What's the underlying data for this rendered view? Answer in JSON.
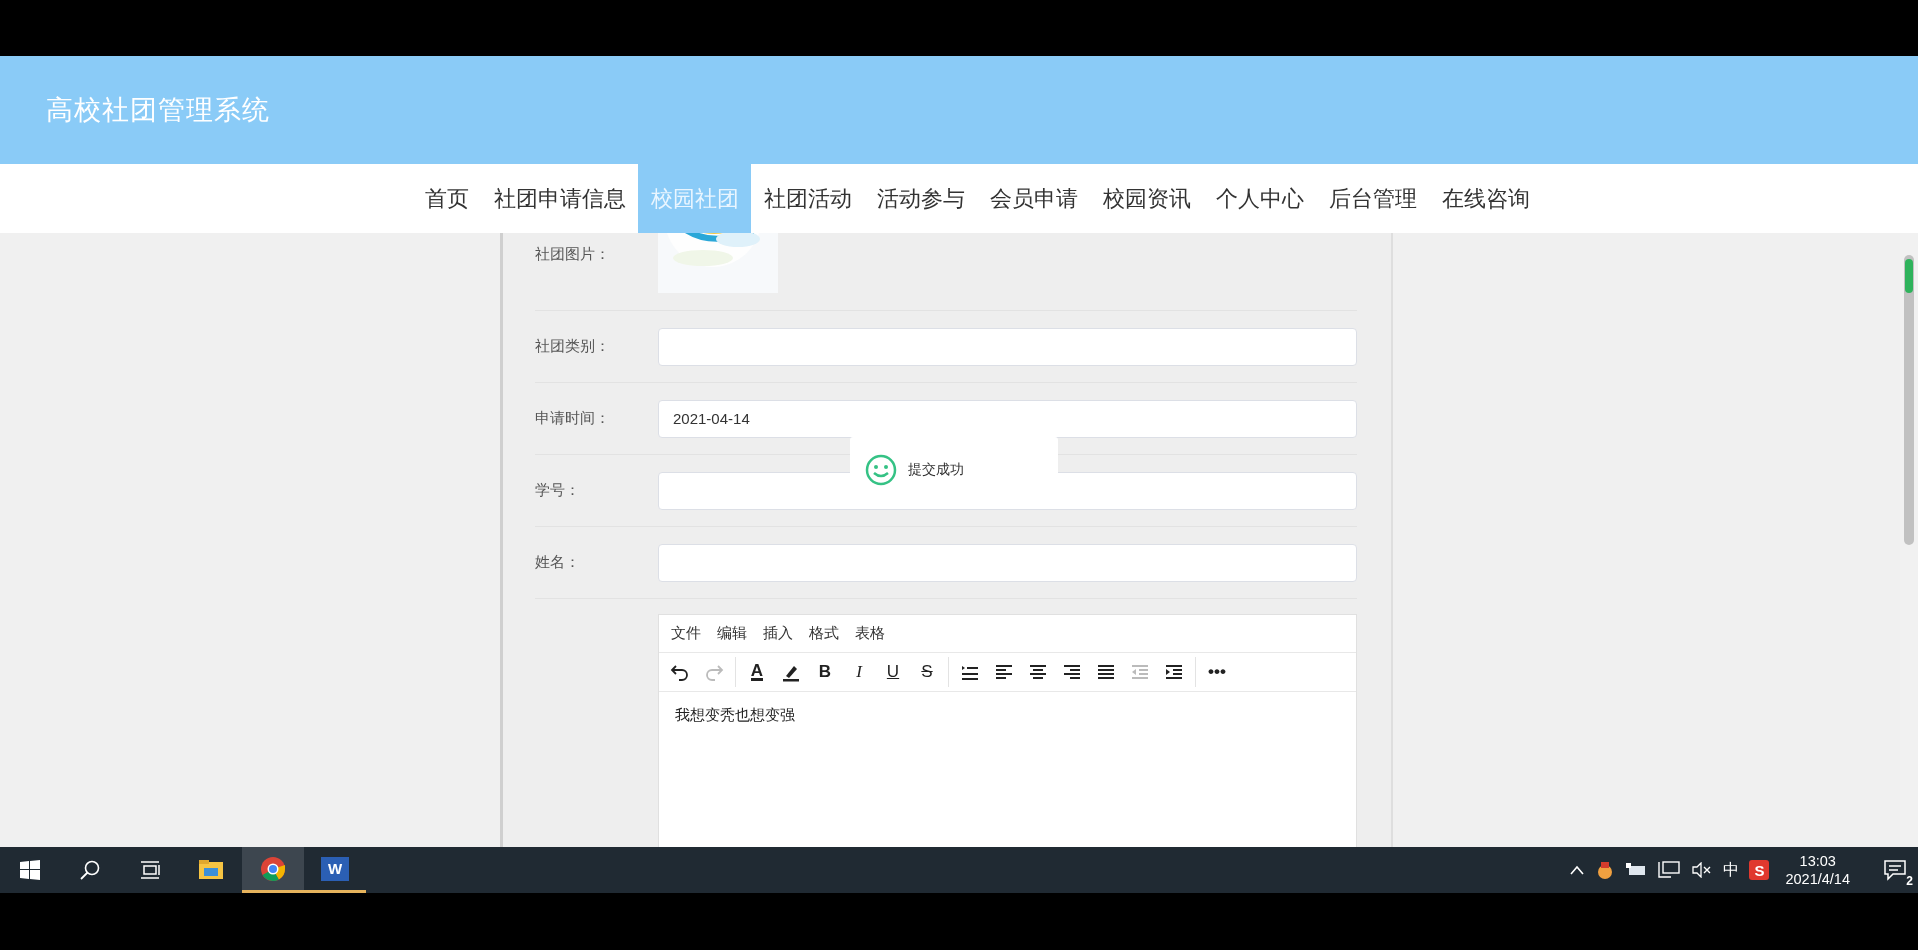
{
  "header": {
    "title": "高校社团管理系统"
  },
  "nav": [
    {
      "label": "首页",
      "selected": false
    },
    {
      "label": "社团申请信息",
      "selected": false
    },
    {
      "label": "校园社团",
      "selected": true
    },
    {
      "label": "社团活动",
      "selected": false
    },
    {
      "label": "活动参与",
      "selected": false
    },
    {
      "label": "会员申请",
      "selected": false
    },
    {
      "label": "校园资讯",
      "selected": false
    },
    {
      "label": "个人中心",
      "selected": false
    },
    {
      "label": "后台管理",
      "selected": false
    },
    {
      "label": "在线咨询",
      "selected": false
    }
  ],
  "form": [
    {
      "label": "社团图片："
    },
    {
      "kind": "field",
      "label": "社团类别："
    },
    {
      "kind": "field",
      "label": "申请时间：",
      "value": "2021-04-14"
    },
    {
      "kind": "field",
      "label": "学号："
    },
    {
      "kind": "field",
      "label": "姓名："
    }
  ],
  "editor": {
    "menu": [
      "文件",
      "编辑",
      "插入",
      "格式",
      "表格"
    ],
    "toolbar": [
      [
        {
          "kind": "undo",
          "disabled": false
        },
        {
          "kind": "redo",
          "disabled": true
        }
      ],
      [
        {
          "kind": "text-color",
          "glyph": "A",
          "disabled": false
        },
        {
          "kind": "highlight",
          "disabled": false
        },
        {
          "kind": "bold",
          "glyph": "B",
          "disabled": false
        },
        {
          "kind": "italic",
          "glyph": "I",
          "disabled": false
        },
        {
          "kind": "underline",
          "glyph": "U",
          "disabled": false
        },
        {
          "kind": "strike",
          "glyph": "S",
          "disabled": false
        }
      ],
      [
        {
          "kind": "list",
          "disabled": false
        },
        {
          "kind": "align-left",
          "disabled": false
        },
        {
          "kind": "align-center",
          "disabled": false
        },
        {
          "kind": "align-right",
          "disabled": false
        },
        {
          "kind": "justify",
          "disabled": false
        },
        {
          "kind": "outdent",
          "disabled": true
        },
        {
          "kind": "indent",
          "disabled": false
        }
      ],
      [
        {
          "kind": "more",
          "glyph": "•••",
          "disabled": false
        }
      ]
    ],
    "content": "我想变秃也想变强"
  },
  "toast": {
    "message": "提交成功"
  },
  "taskbar": {
    "apps": [
      {
        "kind": "explorer",
        "running": false,
        "selected": false
      },
      {
        "kind": "browser",
        "running": true,
        "selected": true
      },
      {
        "kind": "word",
        "glyph": "W",
        "running": true,
        "selected": false
      }
    ],
    "ime": "中",
    "tray_app_glyph": "S",
    "time": "13:03",
    "date": "2021/4/14",
    "notifications": "2"
  }
}
